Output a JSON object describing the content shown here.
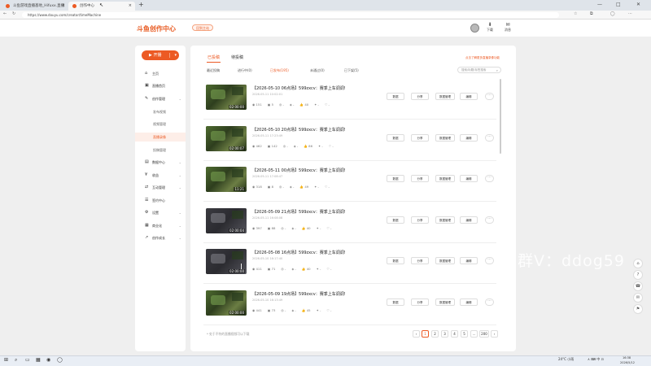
{
  "browser": {
    "tabs": [
      {
        "label": "斗鱼游戏直播基地_Hifuxx.直播 次",
        "active": false
      },
      {
        "label": "创作中心",
        "active": true
      }
    ],
    "new_tab": "+",
    "window_buttons": [
      "—",
      "□",
      "✕"
    ],
    "url": "https://www.douyu.com/creator/timeMachine"
  },
  "site": {
    "logo": "斗鱼创作中心",
    "logo_badge": "回到主站",
    "header_icons": [
      {
        "icon": "avatar",
        "label": ""
      },
      {
        "icon": "download-icon",
        "label": "下载"
      },
      {
        "icon": "message-icon",
        "label": "消息"
      }
    ]
  },
  "sidebar": {
    "start_button": "开播",
    "items": [
      {
        "icon": "home-icon",
        "label": "主页",
        "chevron": false
      },
      {
        "icon": "live-icon",
        "label": "直播首页",
        "chevron": false
      },
      {
        "icon": "create-icon",
        "label": "创作管理",
        "chevron": true
      },
      {
        "sub": true,
        "label": "发布视频",
        "active": false
      },
      {
        "sub": true,
        "label": "视频管理",
        "active": false
      },
      {
        "sub": true,
        "label": "直播录像",
        "active": true
      },
      {
        "sub": true,
        "label": "投稿管理",
        "active": false
      },
      {
        "icon": "data-icon",
        "label": "数据中心",
        "chevron": true
      },
      {
        "icon": "income-icon",
        "label": "收益",
        "chevron": true
      },
      {
        "icon": "interact-icon",
        "label": "互动管理",
        "chevron": true
      },
      {
        "icon": "help-icon",
        "label": "签约中心",
        "chevron": false
      },
      {
        "icon": "settings-icon",
        "label": "设置",
        "chevron": true
      },
      {
        "icon": "business-icon",
        "label": "商业化",
        "chevron": true
      },
      {
        "icon": "growth-icon",
        "label": "创作成长",
        "chevron": true
      }
    ]
  },
  "main": {
    "tabs": [
      {
        "label": "已投稿",
        "active": true
      },
      {
        "label": "待投稿",
        "active": false
      }
    ],
    "filters": [
      {
        "label": "最近投稿",
        "active": false
      },
      {
        "label": "进行中(0)",
        "active": false
      },
      {
        "label": "已发布(195)",
        "active": true
      },
      {
        "label": "未通过(0)",
        "active": false
      },
      {
        "label": "已下架(5)",
        "active": false
      }
    ],
    "search_placeholder": "搜索/标题/标签搜索",
    "top_right_link": "点击了解更多直播录像功能",
    "action_labels": [
      "数据",
      "分享",
      "数据管理",
      "编辑"
    ],
    "more_label": "···",
    "rows": [
      {
        "title": "【2026-05-10 06点场】599zxcv：赛季上车调调!",
        "date": "2026-05-11 10:02:01",
        "duration": "02:00:00",
        "thumb": "green",
        "stats": [
          "◉ 151",
          "▣ 5",
          "◎ -",
          "◈ -",
          "👍 40",
          "✦ -",
          "♡ -"
        ]
      },
      {
        "title": "【2026-05-10 20点场】599zxcv：赛季上车调调!",
        "date": "2026-05-11 17:23:49",
        "duration": "02:00:07",
        "thumb": "green",
        "stats": [
          "◉ 462",
          "▣ 142",
          "◎ -",
          "◈ -",
          "👍 86",
          "✦ -",
          "♡ -"
        ]
      },
      {
        "title": "【2026-05-11 00点场】599zxcv：赛季上车调调!",
        "date": "2026-05-11 17:08:47",
        "duration": "11:21",
        "thumb": "green",
        "stats": [
          "◉ 318",
          "▣ 8",
          "◎ -",
          "◈ -",
          "👍 49",
          "✦ -",
          "♡ -"
        ]
      },
      {
        "title": "【2026-05-09 21点场】599zxcv：赛季上车调调!",
        "date": "2026-05-11 16:08:08",
        "duration": "02:00:04",
        "thumb": "dark",
        "stats": [
          "◉ 397",
          "▣ 88",
          "◎ -",
          "◈ -",
          "👍 40",
          "✦ -",
          "♡ -"
        ]
      },
      {
        "title": "【2026-05-08 16点场】599zxcv：赛季上车调调!",
        "date": "2026-05-10 16:17:40",
        "duration": "02:00:00",
        "thumb": "dark",
        "stats": [
          "◉ 411",
          "▣ 71",
          "◎ -",
          "◈ -",
          "👍 40",
          "✦ -",
          "♡ -"
        ]
      },
      {
        "title": "【2026-05-09 19点场】599zxcv：赛季上车调调!",
        "date": "2026-05-10 16:13:49",
        "duration": "02:00:00",
        "thumb": "green",
        "stats": [
          "◉ 441",
          "▣ 73",
          "◎ -",
          "◈ -",
          "👍 45",
          "✦ -",
          "♡ -"
        ]
      }
    ],
    "footnote": "* 处于不符的直播视频可以下载",
    "pagination": [
      "‹",
      "1",
      "2",
      "3",
      "4",
      "5",
      "…",
      "200",
      "›"
    ]
  },
  "watermark": "友群V：ddog59",
  "right_tools": [
    "⌂",
    "?",
    "☎",
    "✉",
    "⚑"
  ],
  "taskbar": {
    "icons": [
      "⊞",
      "⌕",
      "▭",
      "▦",
      "◉",
      "◯"
    ],
    "weather": "24°C 小雨",
    "tray": "∧ ⌨ 中 ⊡",
    "time": "16:38",
    "date": "2026/5/12"
  },
  "colors": {
    "accent": "#ec5a24",
    "page_bg": "#efefef"
  }
}
